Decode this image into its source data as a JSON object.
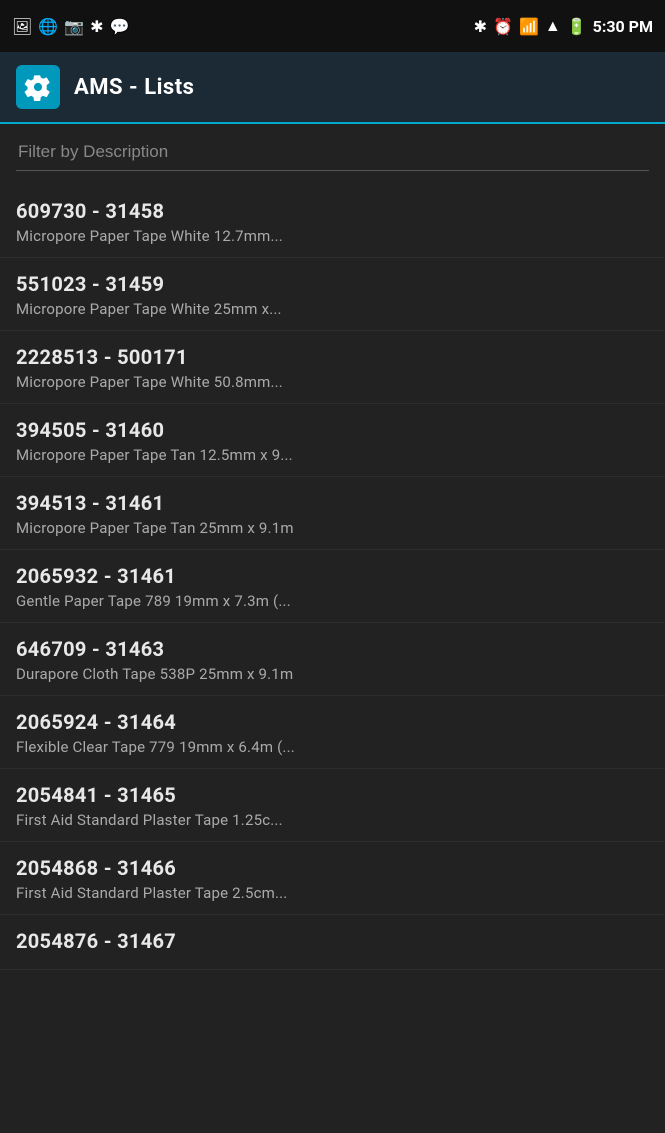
{
  "statusBar": {
    "time": "5:30 PM",
    "leftIcons": [
      "🖼",
      "🌐",
      "📷",
      "🔵",
      "💬"
    ],
    "rightIcons": [
      "✱",
      "⏰",
      "📶",
      "▲",
      "🔋"
    ]
  },
  "titleBar": {
    "title": "AMS - Lists",
    "iconAlt": "settings-gear"
  },
  "filter": {
    "placeholder": "Filter by Description"
  },
  "items": [
    {
      "code": "609730 - 31458",
      "description": "Micropore Paper Tape White 12.7mm..."
    },
    {
      "code": "551023 - 31459",
      "description": "Micropore Paper Tape White 25mm x..."
    },
    {
      "code": "2228513 - 500171",
      "description": "Micropore Paper Tape White 50.8mm..."
    },
    {
      "code": "394505 - 31460",
      "description": "Micropore Paper Tape Tan 12.5mm x 9..."
    },
    {
      "code": "394513 - 31461",
      "description": "Micropore Paper Tape Tan 25mm x 9.1m"
    },
    {
      "code": "2065932 - 31461",
      "description": "Gentle Paper Tape 789 19mm x 7.3m (..."
    },
    {
      "code": "646709 - 31463",
      "description": "Durapore Cloth Tape 538P 25mm x 9.1m"
    },
    {
      "code": "2065924 - 31464",
      "description": "Flexible Clear Tape 779 19mm x 6.4m (..."
    },
    {
      "code": "2054841 - 31465",
      "description": "First Aid Standard Plaster Tape 1.25c..."
    },
    {
      "code": "2054868 - 31466",
      "description": "First Aid Standard Plaster Tape 2.5cm..."
    },
    {
      "code": "2054876 - 31467",
      "description": ""
    }
  ]
}
